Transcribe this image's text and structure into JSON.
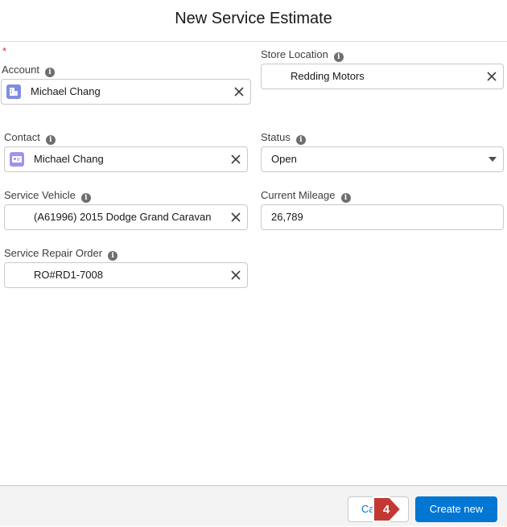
{
  "modal": {
    "title": "New Service Estimate",
    "required_marker": "*"
  },
  "fields": {
    "account": {
      "label": "Account",
      "value": "Michael Chang",
      "icon": "account-icon"
    },
    "store_location": {
      "label": "Store Location",
      "value": "Redding Motors"
    },
    "contact": {
      "label": "Contact",
      "value": "Michael Chang",
      "icon": "contact-icon"
    },
    "status": {
      "label": "Status",
      "value": "Open"
    },
    "service_vehicle": {
      "label": "Service Vehicle",
      "value": "(A61996) 2015 Dodge Grand Caravan"
    },
    "current_mileage": {
      "label": "Current Mileage",
      "value": "26,789"
    },
    "service_repair_order": {
      "label": "Service Repair Order",
      "value": "RO#RD1-7008"
    }
  },
  "footer": {
    "cancel_label": "Cancel",
    "create_label": "Create new"
  },
  "annotation": {
    "step_number": "4"
  },
  "colors": {
    "brand_blue": "#0176d3",
    "required_red": "#c23934",
    "badge_red": "#c23934",
    "account_icon": "#7f8de1",
    "contact_icon": "#a094ed"
  }
}
